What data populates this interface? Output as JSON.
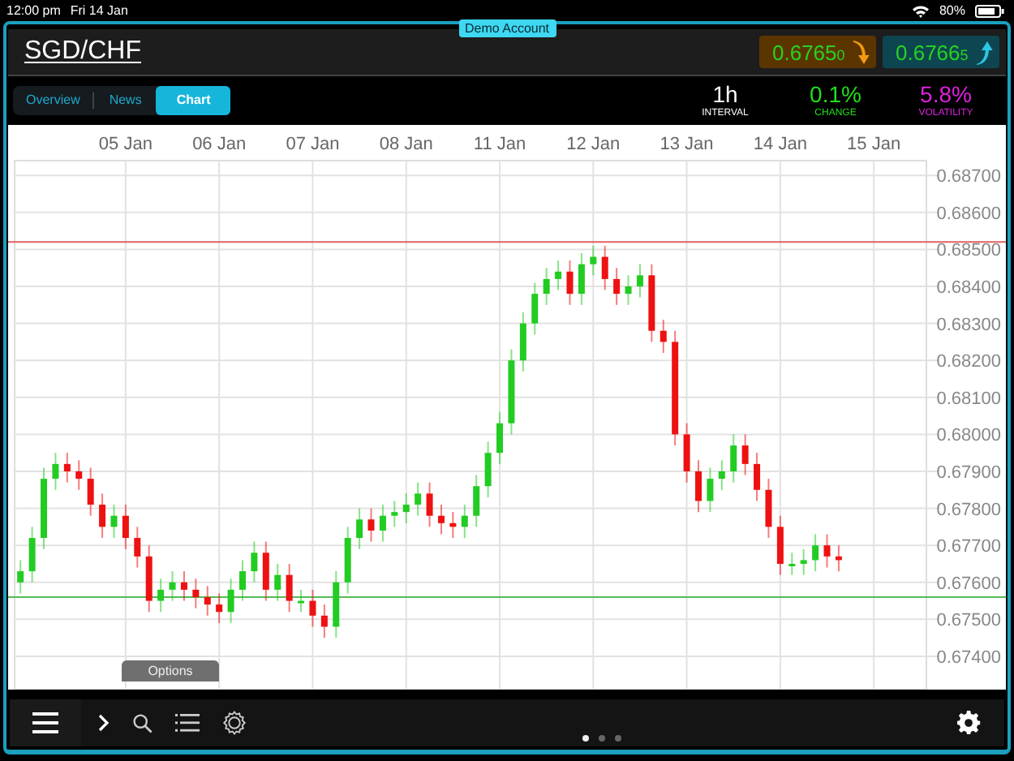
{
  "status_bar": {
    "time": "12:00 pm",
    "date": "Fri 14 Jan",
    "battery": "80%"
  },
  "account_badge": "Demo Account",
  "instrument": "SGD/CHF",
  "prices": [
    {
      "kind": "sell",
      "main": "0.6765",
      "small": "0"
    },
    {
      "kind": "buy",
      "main": "0.6766",
      "small": "5"
    }
  ],
  "tabs": [
    {
      "label": "Overview",
      "selected": false
    },
    {
      "label": "News",
      "selected": false
    },
    {
      "label": "Chart",
      "selected": true
    }
  ],
  "stats": [
    {
      "value": "1h",
      "label": "INTERVAL",
      "color": "#ffffff"
    },
    {
      "value": "0.1%",
      "label": "CHANGE",
      "color": "#22e01a"
    },
    {
      "value": "5.8%",
      "label": "VOLATILITY",
      "color": "#e020e0"
    }
  ],
  "chart": {
    "chart_data": {
      "type": "candlestick",
      "grid": true,
      "ylim": [
        0.6731,
        0.6874
      ],
      "categories": [
        null,
        null,
        null,
        null,
        null,
        null,
        null,
        null,
        null,
        "05 Jan",
        null,
        null,
        null,
        null,
        null,
        null,
        null,
        "06 Jan",
        null,
        null,
        null,
        null,
        null,
        null,
        null,
        "07 Jan",
        null,
        null,
        null,
        null,
        null,
        null,
        null,
        "08 Jan",
        null,
        null,
        null,
        null,
        null,
        null,
        null,
        "11 Jan",
        null,
        null,
        null,
        null,
        null,
        null,
        null,
        "12 Jan",
        null,
        null,
        null,
        null,
        null,
        null,
        null,
        "13 Jan",
        null,
        null,
        null,
        null,
        null,
        null,
        null,
        "14 Jan",
        null,
        null,
        null,
        null,
        null,
        null,
        null,
        "15 Jan",
        null,
        null,
        null,
        null
      ],
      "yticks": [
        {
          "value": 0.687,
          "label": "0.68700"
        },
        {
          "value": 0.686,
          "label": "0.68600"
        },
        {
          "value": 0.685,
          "label": "0.68500"
        },
        {
          "value": 0.684,
          "label": "0.68400"
        },
        {
          "value": 0.683,
          "label": "0.68300"
        },
        {
          "value": 0.682,
          "label": "0.68200"
        },
        {
          "value": 0.681,
          "label": "0.68100"
        },
        {
          "value": 0.68,
          "label": "0.68000"
        },
        {
          "value": 0.679,
          "label": "0.67900"
        },
        {
          "value": 0.678,
          "label": "0.67800"
        },
        {
          "value": 0.677,
          "label": "0.67700"
        },
        {
          "value": 0.676,
          "label": "0.67600"
        },
        {
          "value": 0.675,
          "label": "0.67500"
        },
        {
          "value": 0.674,
          "label": "0.67400"
        }
      ],
      "ohlc": [
        [
          0.676,
          0.6766,
          0.6757,
          0.6763
        ],
        [
          0.6763,
          0.6775,
          0.676,
          0.6772
        ],
        [
          0.6772,
          0.6791,
          0.6769,
          0.6788
        ],
        [
          0.6788,
          0.6795,
          0.6785,
          0.6792
        ],
        [
          0.6792,
          0.6795,
          0.6787,
          0.679
        ],
        [
          0.679,
          0.6793,
          0.6785,
          0.6788
        ],
        [
          0.6788,
          0.6791,
          0.6778,
          0.6781
        ],
        [
          0.6781,
          0.6784,
          0.6772,
          0.6775
        ],
        [
          0.6775,
          0.6781,
          0.6772,
          0.6778
        ],
        [
          0.6778,
          0.6781,
          0.6769,
          0.6772
        ],
        [
          0.6772,
          0.6775,
          0.6764,
          0.6767
        ],
        [
          0.6767,
          0.677,
          0.6752,
          0.6755
        ],
        [
          0.6755,
          0.6761,
          0.6752,
          0.6758
        ],
        [
          0.6758,
          0.6763,
          0.6755,
          0.676
        ],
        [
          0.676,
          0.6763,
          0.6755,
          0.6758
        ],
        [
          0.6758,
          0.6761,
          0.6753,
          0.6756
        ],
        [
          0.6756,
          0.6759,
          0.6751,
          0.6754
        ],
        [
          0.6754,
          0.6757,
          0.6749,
          0.6752
        ],
        [
          0.6752,
          0.6761,
          0.6749,
          0.6758
        ],
        [
          0.6758,
          0.6766,
          0.6755,
          0.6763
        ],
        [
          0.6763,
          0.6771,
          0.676,
          0.6768
        ],
        [
          0.6768,
          0.6771,
          0.6755,
          0.6758
        ],
        [
          0.6758,
          0.6765,
          0.6755,
          0.6762
        ],
        [
          0.6762,
          0.6765,
          0.6752,
          0.6755
        ],
        [
          0.6755,
          0.6758,
          0.6752,
          0.6755
        ],
        [
          0.6755,
          0.6758,
          0.6748,
          0.6751
        ],
        [
          0.6751,
          0.6754,
          0.6745,
          0.6748
        ],
        [
          0.6748,
          0.6763,
          0.6745,
          0.676
        ],
        [
          0.676,
          0.6775,
          0.6757,
          0.6772
        ],
        [
          0.6772,
          0.678,
          0.6769,
          0.6777
        ],
        [
          0.6777,
          0.678,
          0.6771,
          0.6774
        ],
        [
          0.6774,
          0.6781,
          0.6771,
          0.6778
        ],
        [
          0.6778,
          0.6782,
          0.6775,
          0.6779
        ],
        [
          0.6779,
          0.6784,
          0.6776,
          0.6781
        ],
        [
          0.6781,
          0.6787,
          0.6778,
          0.6784
        ],
        [
          0.6784,
          0.6787,
          0.6775,
          0.6778
        ],
        [
          0.6778,
          0.6781,
          0.6773,
          0.6776
        ],
        [
          0.6776,
          0.6779,
          0.6772,
          0.6775
        ],
        [
          0.6775,
          0.6781,
          0.6772,
          0.6778
        ],
        [
          0.6778,
          0.6789,
          0.6775,
          0.6786
        ],
        [
          0.6786,
          0.6798,
          0.6783,
          0.6795
        ],
        [
          0.6795,
          0.6806,
          0.6792,
          0.6803
        ],
        [
          0.6803,
          0.6823,
          0.68,
          0.682
        ],
        [
          0.682,
          0.6833,
          0.6817,
          0.683
        ],
        [
          0.683,
          0.6841,
          0.6827,
          0.6838
        ],
        [
          0.6838,
          0.6845,
          0.6835,
          0.6842
        ],
        [
          0.6842,
          0.6847,
          0.6839,
          0.6844
        ],
        [
          0.6844,
          0.6847,
          0.6835,
          0.6838
        ],
        [
          0.6838,
          0.6849,
          0.6835,
          0.6846
        ],
        [
          0.6846,
          0.6851,
          0.6843,
          0.6848
        ],
        [
          0.6848,
          0.6851,
          0.6839,
          0.6842
        ],
        [
          0.6842,
          0.6845,
          0.6835,
          0.6838
        ],
        [
          0.6838,
          0.6843,
          0.6835,
          0.684
        ],
        [
          0.684,
          0.6846,
          0.6837,
          0.6843
        ],
        [
          0.6843,
          0.6846,
          0.6825,
          0.6828
        ],
        [
          0.6828,
          0.6831,
          0.6822,
          0.6825
        ],
        [
          0.6825,
          0.6828,
          0.6797,
          0.68
        ],
        [
          0.68,
          0.6803,
          0.6787,
          0.679
        ],
        [
          0.679,
          0.6793,
          0.6779,
          0.6782
        ],
        [
          0.6782,
          0.6791,
          0.6779,
          0.6788
        ],
        [
          0.6788,
          0.6793,
          0.6785,
          0.679
        ],
        [
          0.679,
          0.68,
          0.6787,
          0.6797
        ],
        [
          0.6797,
          0.68,
          0.6789,
          0.6792
        ],
        [
          0.6792,
          0.6795,
          0.6782,
          0.6785
        ],
        [
          0.6785,
          0.6788,
          0.6772,
          0.6775
        ],
        [
          0.6775,
          0.6778,
          0.6762,
          0.6765
        ],
        [
          0.6765,
          0.6768,
          0.6762,
          0.6765
        ],
        [
          0.6765,
          0.6769,
          0.6762,
          0.6766
        ],
        [
          0.6766,
          0.6773,
          0.6763,
          0.677
        ],
        [
          0.677,
          0.6773,
          0.6764,
          0.6767
        ],
        [
          0.6767,
          0.677,
          0.6763,
          0.6766
        ],
        null,
        null,
        null,
        null,
        null,
        null,
        null
      ],
      "ref_lines": [
        {
          "axis": "y",
          "value": 0.6852,
          "color": "#e06060"
        },
        {
          "axis": "y",
          "value": 0.6756,
          "color": "#55bb55"
        }
      ]
    }
  },
  "options_tab": "Options",
  "toolbar": {
    "page_dots": [
      {
        "selected": true
      },
      {
        "selected": false
      },
      {
        "selected": false
      }
    ]
  }
}
